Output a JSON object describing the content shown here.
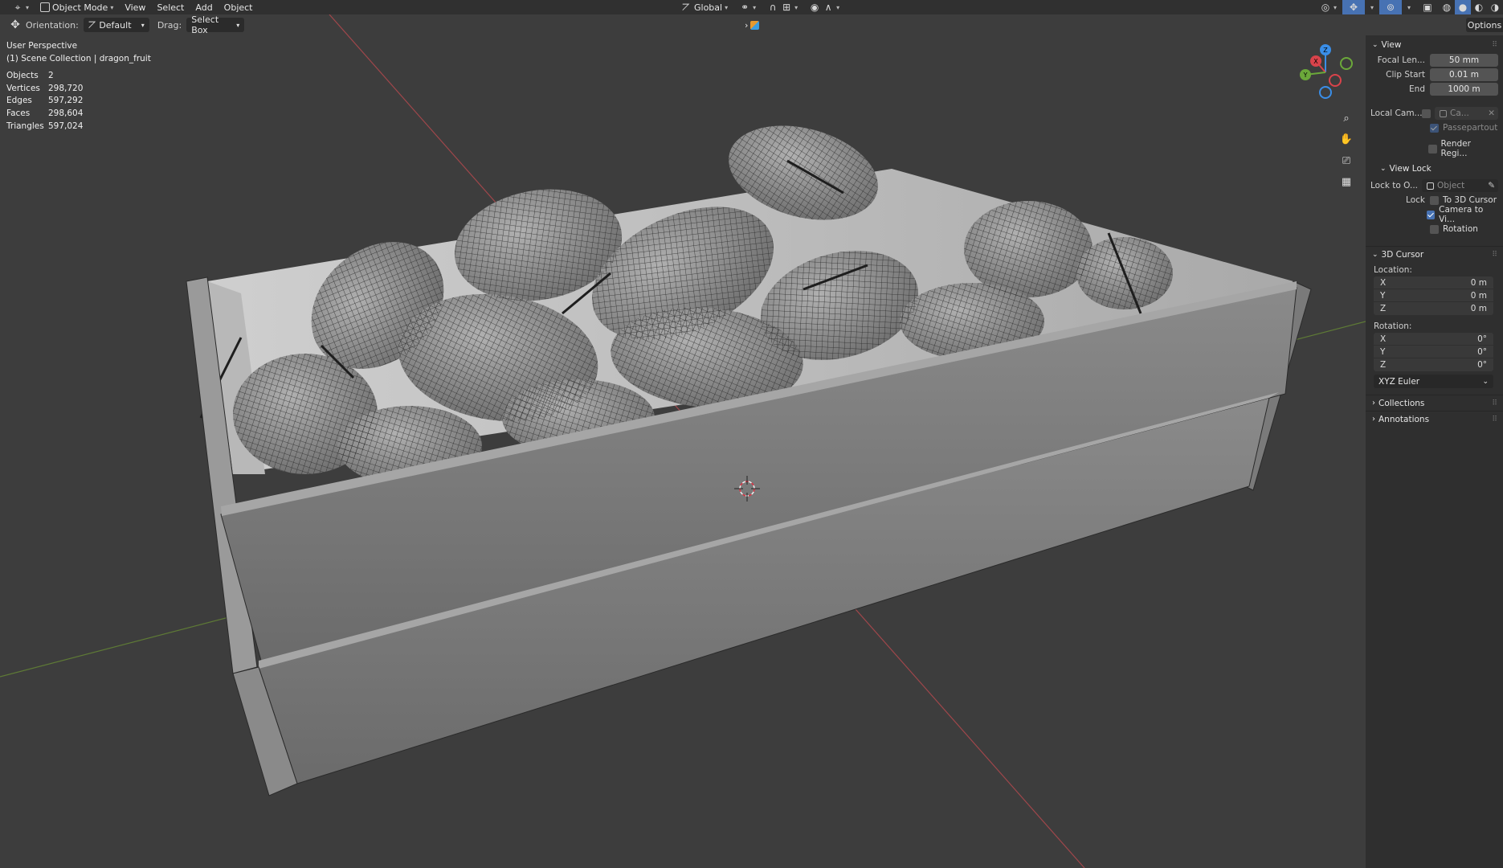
{
  "header": {
    "mode_label": "Object Mode",
    "menus": [
      "View",
      "Select",
      "Add",
      "Object"
    ],
    "transform_orientation": "Global",
    "options_label": "Options"
  },
  "tool_settings": {
    "orientation_label": "Orientation:",
    "orientation_value": "Default",
    "drag_label": "Drag:",
    "drag_value": "Select Box"
  },
  "viewport": {
    "perspective_label": "User Perspective",
    "collection_label": "(1) Scene Collection | dragon_fruit",
    "stats": [
      {
        "label": "Objects",
        "value": "2"
      },
      {
        "label": "Vertices",
        "value": "298,720"
      },
      {
        "label": "Edges",
        "value": "597,292"
      },
      {
        "label": "Faces",
        "value": "298,604"
      },
      {
        "label": "Triangles",
        "value": "597,024"
      }
    ],
    "gizmo": {
      "x": "X",
      "y": "Y",
      "z": "Z"
    },
    "colors": {
      "x_axis": "#d9434b",
      "y_axis": "#6ba83a",
      "z_axis": "#3a8ee8",
      "background": "#3d3d3d"
    }
  },
  "sidebar": {
    "view_panel": {
      "title": "View",
      "focal_length_label": "Focal Len...",
      "focal_length_value": "50 mm",
      "clip_start_label": "Clip Start",
      "clip_start_value": "0.01 m",
      "end_label": "End",
      "end_value": "1000 m",
      "local_camera_label": "Local Cam...",
      "local_camera_value": "Ca...",
      "passepartout_label": "Passepartout",
      "render_region_label": "Render Regi..."
    },
    "view_lock_panel": {
      "title": "View Lock",
      "lock_to_object_label": "Lock to O...",
      "lock_to_object_placeholder": "Object",
      "lock_label": "Lock",
      "to_3d_cursor_label": "To 3D Cursor",
      "camera_to_view_label": "Camera to Vi...",
      "rotation_label": "Rotation"
    },
    "cursor_panel": {
      "title": "3D Cursor",
      "location_label": "Location:",
      "location": [
        {
          "axis": "X",
          "value": "0 m"
        },
        {
          "axis": "Y",
          "value": "0 m"
        },
        {
          "axis": "Z",
          "value": "0 m"
        }
      ],
      "rotation_label": "Rotation:",
      "rotation": [
        {
          "axis": "X",
          "value": "0°"
        },
        {
          "axis": "Y",
          "value": "0°"
        },
        {
          "axis": "Z",
          "value": "0°"
        }
      ],
      "rotation_mode": "XYZ Euler"
    },
    "collections_title": "Collections",
    "annotations_title": "Annotations"
  }
}
